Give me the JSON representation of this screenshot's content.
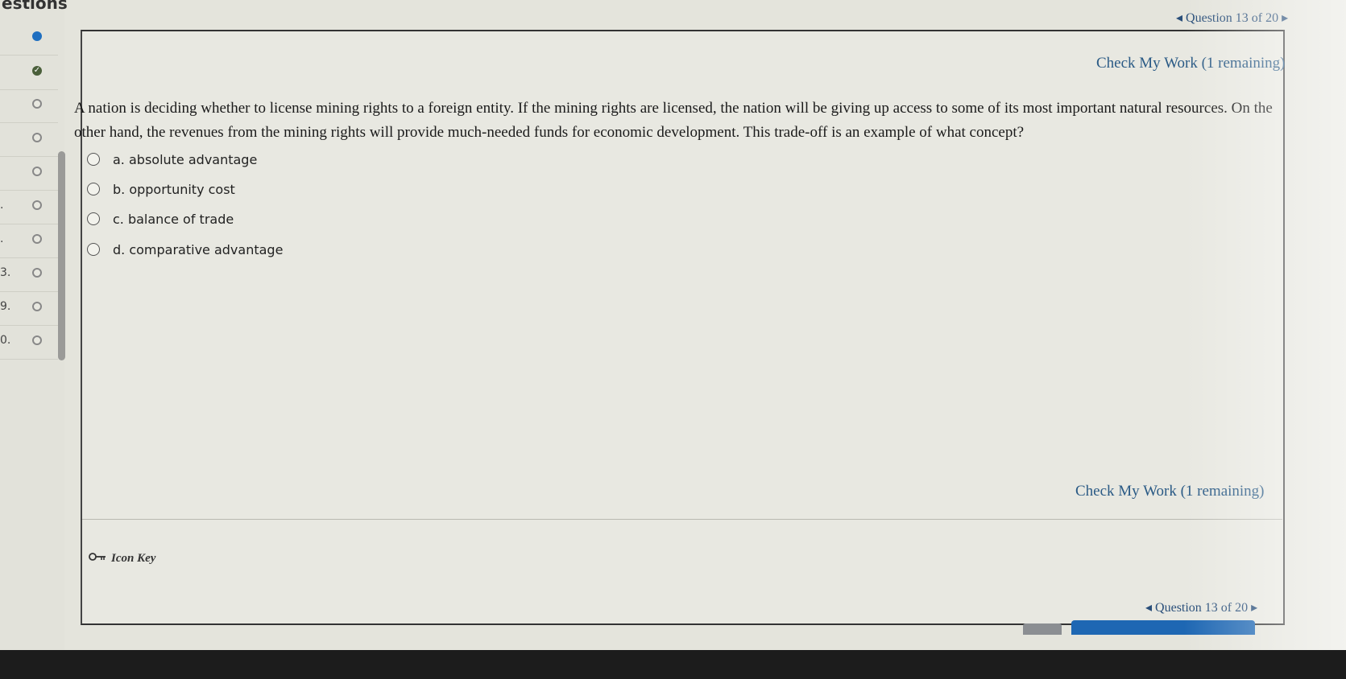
{
  "sidebar": {
    "header": "estions",
    "rows": [
      {
        "num": "",
        "status": "current"
      },
      {
        "num": "",
        "status": "done"
      },
      {
        "num": "",
        "status": "empty"
      },
      {
        "num": "",
        "status": "empty"
      },
      {
        "num": "",
        "status": "empty"
      },
      {
        "num": ".",
        "status": "empty"
      },
      {
        "num": ".",
        "status": "empty"
      },
      {
        "num": "3.",
        "status": "empty"
      },
      {
        "num": "9.",
        "status": "empty"
      },
      {
        "num": "0.",
        "status": "empty"
      }
    ]
  },
  "nav": {
    "prev_arrow": "◂",
    "next_arrow": "▸",
    "label": "Question 13 of 20"
  },
  "check_work": {
    "label": "Check My Work (1 remaining)"
  },
  "question": {
    "text": "A nation is deciding whether to license mining rights to a foreign entity. If the mining rights are licensed, the nation will be giving up access to some of its most important natural resources. On the other hand, the revenues from the mining rights will provide much-needed funds for economic development. This trade-off is an example of what concept?",
    "options": [
      "a. absolute advantage",
      "b. opportunity cost",
      "c. balance of trade",
      "d. comparative advantage"
    ]
  },
  "footer": {
    "icon_key_label": "Icon Key"
  },
  "colors": {
    "link": "#2a5a85",
    "current": "#1f6fc0",
    "primary_button": "#1e67b3"
  }
}
